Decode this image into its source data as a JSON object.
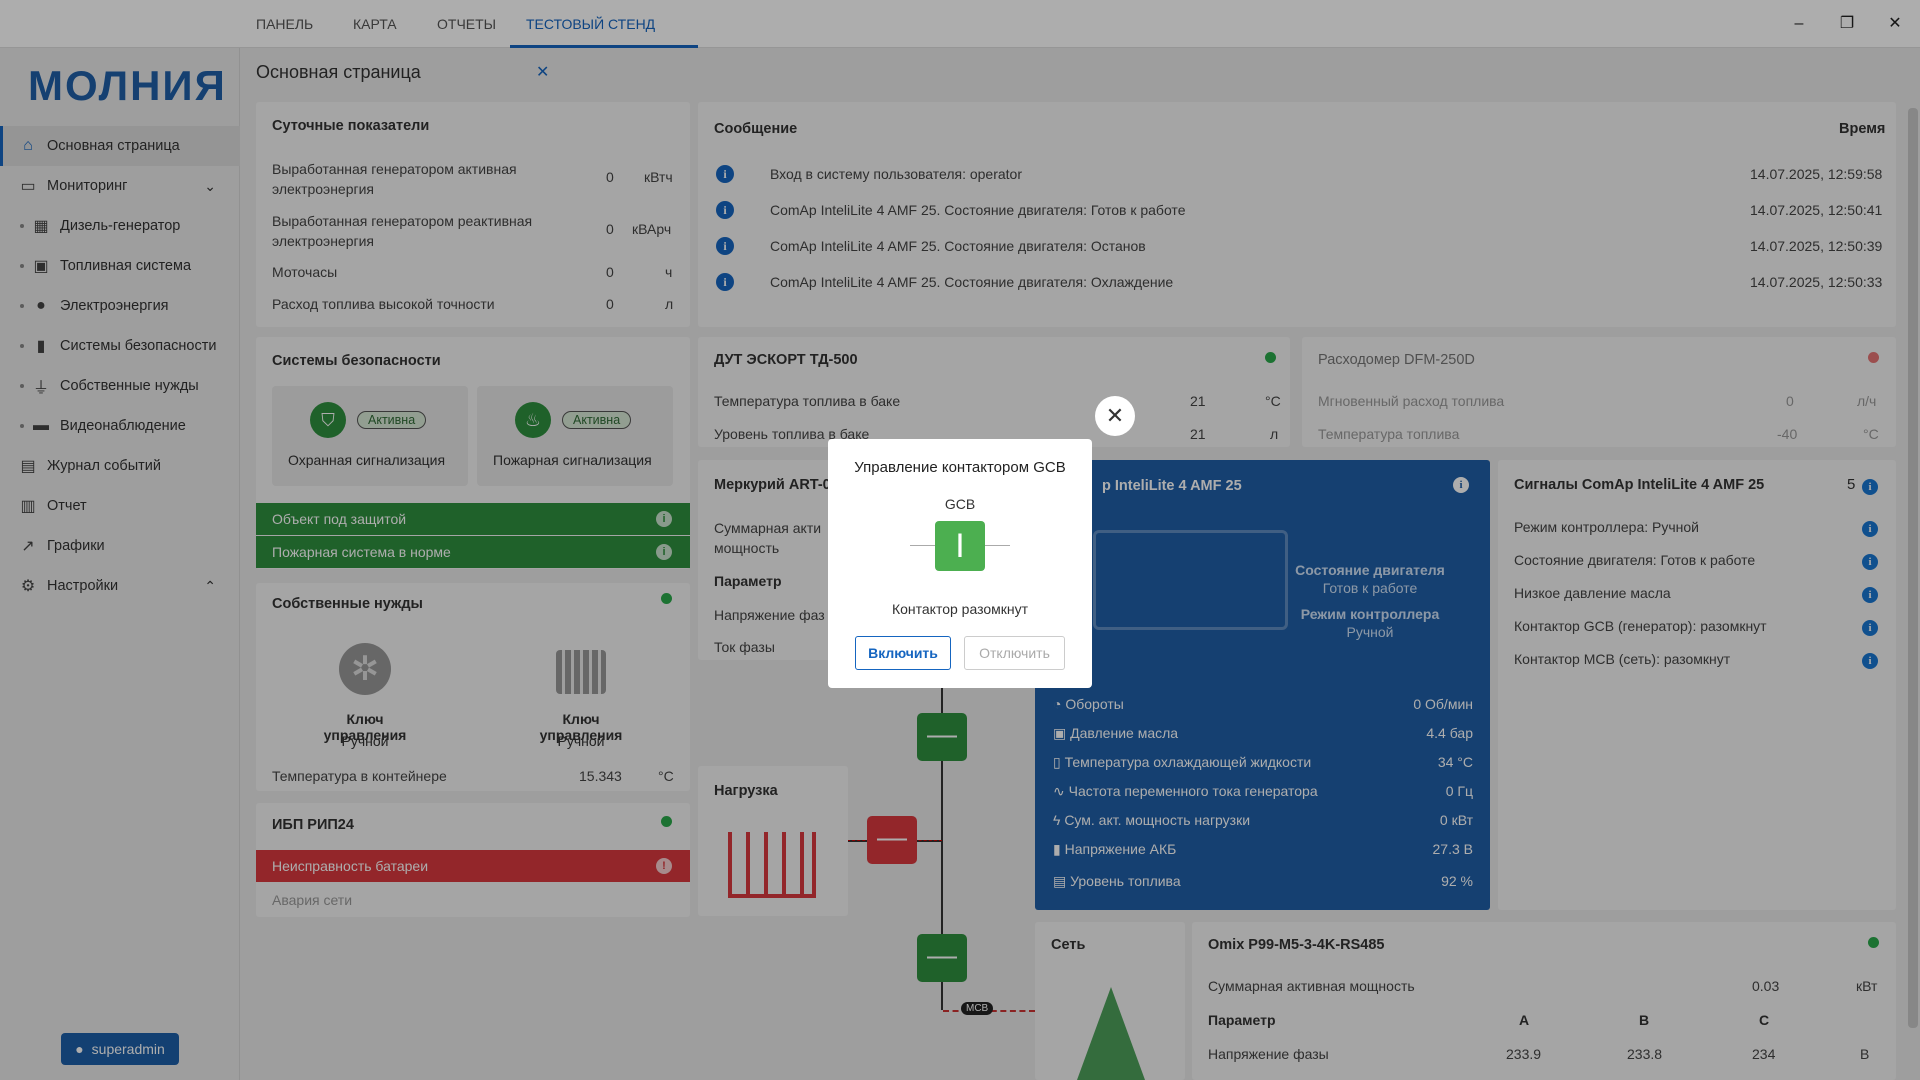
{
  "tabs": [
    "ПАНЕЛЬ",
    "КАРТА",
    "ОТЧЕТЫ",
    "ТЕСТОВЫЙ СТЕНД"
  ],
  "window": {
    "minimize": "–",
    "maximize": "❐",
    "close": "✕"
  },
  "logo": "МОЛНИЯ",
  "page_title": "Основная страница",
  "nav": [
    {
      "label": "Основная страница"
    },
    {
      "label": "Мониторинг"
    },
    {
      "label": "Дизель-генератор"
    },
    {
      "label": "Топливная система"
    },
    {
      "label": "Электроэнергия"
    },
    {
      "label": "Системы безопасности"
    },
    {
      "label": "Собственные нужды"
    },
    {
      "label": "Видеонаблюдение"
    },
    {
      "label": "Журнал событий"
    },
    {
      "label": "Отчет"
    },
    {
      "label": "Графики"
    },
    {
      "label": "Настройки"
    }
  ],
  "user": "superadmin",
  "daily": {
    "title": "Суточные показатели",
    "rows": [
      {
        "l1": "Выработанная генератором активная",
        "l2": "электроэнергия",
        "v": "0",
        "u": "кВтч"
      },
      {
        "l1": "Выработанная генератором реактивная",
        "l2": "электроэнергия",
        "v": "0",
        "u": "кВАрч"
      },
      {
        "l1": "Моточасы",
        "l2": "",
        "v": "0",
        "u": "ч"
      },
      {
        "l1": "Расход топлива высокой точности",
        "l2": "",
        "v": "0",
        "u": "л"
      }
    ]
  },
  "security": {
    "title": "Системы безопасности",
    "a": {
      "badge": "Активна",
      "label": "Охранная сигнализация"
    },
    "b": {
      "badge": "Активна",
      "label": "Пожарная сигнализация"
    },
    "bar1": "Объект под защитой",
    "bar2": "Пожарная система в норме"
  },
  "aux": {
    "title": "Собственные нужды",
    "k1": "Ключ управления",
    "m1": "Ручной",
    "k2": "Ключ управления",
    "m2": "Ручной",
    "temp_label": "Температура в контейнере",
    "temp_val": "15.343",
    "temp_unit": "°C"
  },
  "ups": {
    "title": "ИБП РИП24",
    "bar": "Неисправность батареи",
    "row": "Авария сети"
  },
  "messages": {
    "title": "Сообщение",
    "time_title": "Время",
    "items": [
      {
        "text": "Вход в систему пользователя: operator",
        "time": "14.07.2025, 12:59:58"
      },
      {
        "text": "ComAp InteliLite 4 AMF 25. Состояние двигателя: Готов к работе",
        "time": "14.07.2025, 12:50:41"
      },
      {
        "text": "ComAp InteliLite 4 AMF 25. Состояние двигателя: Останов",
        "time": "14.07.2025, 12:50:39"
      },
      {
        "text": "ComAp InteliLite 4 AMF 25. Состояние двигателя: Охлаждение",
        "time": "14.07.2025, 12:50:33"
      }
    ]
  },
  "dut": {
    "title": "ДУТ ЭСКОРТ ТД-500",
    "r1": "Температура топлива в баке",
    "v1": "21",
    "u1": "°C",
    "r2": "Уровень топлива в баке",
    "v2": "21",
    "u2": "л"
  },
  "flow": {
    "title": "Расходомер DFM-250D",
    "r1": "Мгновенный расход топлива",
    "v1": "0",
    "u1": "л/ч",
    "r2": "Температура топлива",
    "v2": "-40",
    "u2": "°C"
  },
  "mercury": {
    "title": "Меркурий ART-0",
    "r1a": "Суммарная акти",
    "r1b": "мощность",
    "r2": "Параметр",
    "r3": "Напряжение фаз",
    "r4": "Ток фазы"
  },
  "engine": {
    "title": "p InteliLite 4 AMF 25",
    "state_title": "Состояние двигателя",
    "state_val": "Готов к работе",
    "mode_title": "Режим контроллера",
    "mode_val": "Ручной",
    "rows": [
      {
        "label": "Обороты",
        "val": "0 Об/мин",
        "icon": "gauge-icon"
      },
      {
        "label": "Давление масла",
        "val": "4.4 бар",
        "icon": "oil-icon"
      },
      {
        "label": "Температура охлаждающей жидкости",
        "val": "34 °C",
        "icon": "thermometer-icon"
      },
      {
        "label": "Частота переменного тока генератора",
        "val": "0 Гц",
        "icon": "wave-icon"
      },
      {
        "label": "Сум. акт. мощность нагрузки",
        "val": "0 кВт",
        "icon": "bolt-icon"
      },
      {
        "label": "Напряжение АКБ",
        "val": "27.3 В",
        "icon": "battery-icon"
      },
      {
        "label": "Уровень топлива",
        "val": "92 %",
        "icon": "fuel-icon"
      }
    ]
  },
  "signals": {
    "title": "Сигналы ComAp InteliLite 4 AMF 25",
    "count": "5",
    "items": [
      "Режим контроллера: Ручной",
      "Состояние двигателя: Готов к работе",
      "Низкое давление масла",
      "Контактор GCB (генератор): разомкнут",
      "Контактор MCB (сеть): разомкнут"
    ]
  },
  "load": {
    "title": "Нагрузка"
  },
  "grid": {
    "title": "Сеть"
  },
  "mcb": "MCB",
  "omix": {
    "title": "Omix P99-M5-3-4K-RS485",
    "r1": "Суммарная активная мощность",
    "v1": "0.03",
    "u1": "кВт",
    "param": "Параметр",
    "a": "A",
    "b": "B",
    "c": "C",
    "r3": "Напряжение фазы",
    "va": "233.9",
    "vb": "233.8",
    "vc": "234",
    "u3": "В"
  },
  "modal": {
    "title": "Управление контактором GCB",
    "gcb": "GCB",
    "switch_symbol": "I",
    "state": "Контактор разомкнут",
    "on": "Включить",
    "off": "Отключить",
    "close": "✕"
  }
}
